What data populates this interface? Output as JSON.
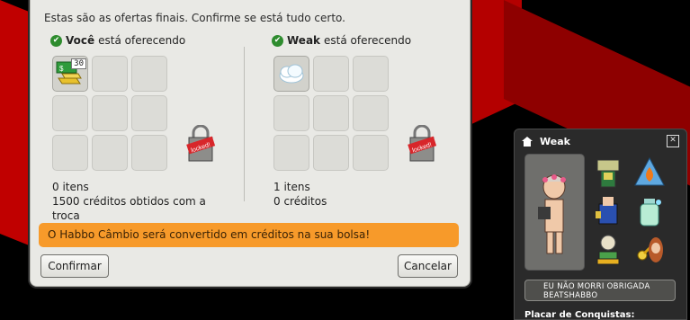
{
  "trade": {
    "message": "Estas são as ofertas finais. Confirme se está tudo certo.",
    "left": {
      "name": "Você",
      "offering_text": "está oferecendo",
      "item_count": "0 itens",
      "credits": "1500 créditos obtidos com a troca",
      "first_slot_badge": "30",
      "lock_label": "locked!"
    },
    "right": {
      "name": "Weak",
      "offering_text": "está oferecendo",
      "item_count": "1 itens",
      "credits": "0 créditos",
      "lock_label": "locked!"
    },
    "banner": "O Habbo Câmbio será convertido em créditos na sua bolsa!",
    "confirm_label": "Confirmar",
    "cancel_label": "Cancelar"
  },
  "profile": {
    "username": "Weak",
    "motto": "EU NÃO MORRI OBRIGADA BEATSHABBO",
    "achievements_label": "Placar de Conquistas:",
    "badge_icons": [
      "robot-badge-icon",
      "fire-triangle-badge-icon",
      "cup-badge-icon",
      "potion-badge-icon",
      "trophy-badge-icon",
      "microphone-badge-icon"
    ]
  },
  "colors": {
    "banner": "#f79a2a",
    "background_red": "#c00000",
    "window": "#e9e9e5"
  }
}
